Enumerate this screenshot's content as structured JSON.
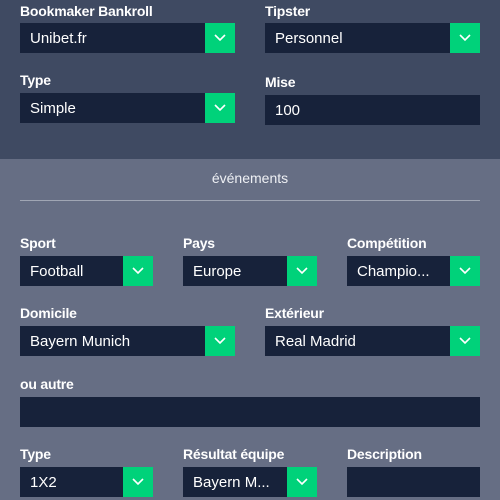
{
  "top": {
    "bookmaker": {
      "label": "Bookmaker Bankroll",
      "value": "Unibet.fr"
    },
    "tipster": {
      "label": "Tipster",
      "value": "Personnel"
    },
    "type": {
      "label": "Type",
      "value": "Simple"
    },
    "mise": {
      "label": "Mise",
      "value": "100"
    }
  },
  "events": {
    "title": "événements",
    "sport": {
      "label": "Sport",
      "value": "Football"
    },
    "pays": {
      "label": "Pays",
      "value": "Europe"
    },
    "competition": {
      "label": "Compétition",
      "value": "Champio..."
    },
    "domicile": {
      "label": "Domicile",
      "value": "Bayern Munich"
    },
    "exterieur": {
      "label": "Extérieur",
      "value": "Real Madrid"
    },
    "autre": {
      "label": "ou autre",
      "value": ""
    },
    "type": {
      "label": "Type",
      "value": "1X2"
    },
    "resultat": {
      "label": "Résultat équipe",
      "value": "Bayern M..."
    },
    "description": {
      "label": "Description",
      "value": ""
    }
  },
  "icons": {
    "dropdown": "chevron-down-icon"
  },
  "colors": {
    "accent": "#00d27a",
    "input_bg": "#17223a",
    "top_bg": "#3f4a62",
    "bottom_bg": "#666e84"
  }
}
